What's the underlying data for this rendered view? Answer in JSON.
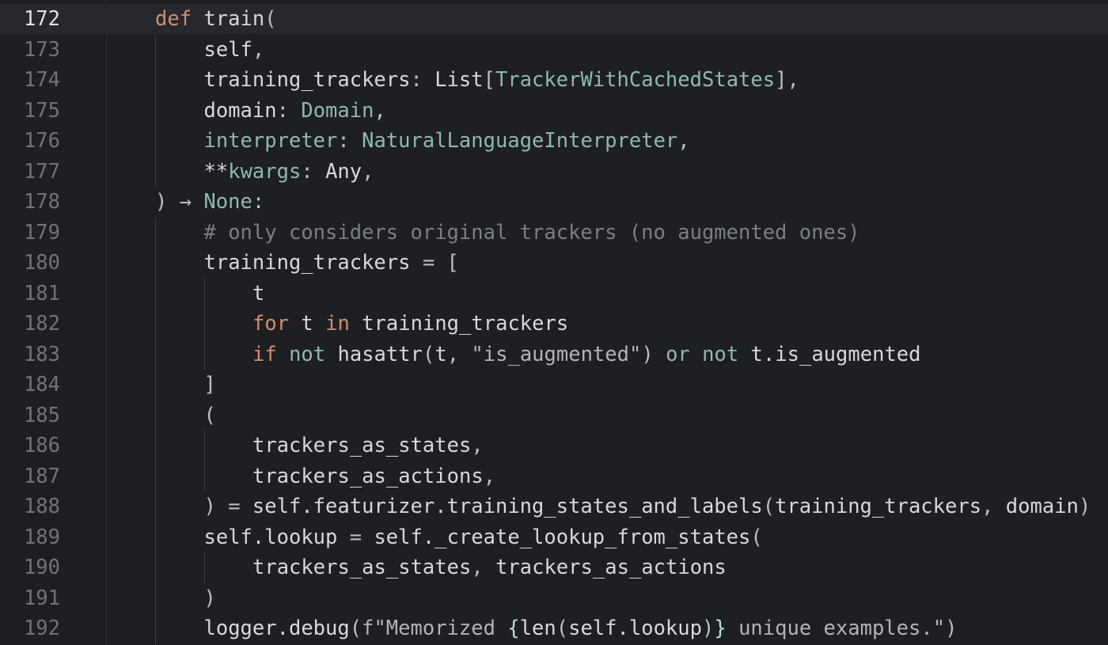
{
  "editor": {
    "current_line": 172,
    "lines": [
      {
        "n": "172",
        "current": true,
        "indent": 0,
        "tokens": [
          [
            "kw",
            "def"
          ],
          [
            "pu",
            " "
          ],
          [
            "fn",
            "train"
          ],
          [
            "pu",
            "("
          ]
        ]
      },
      {
        "n": "173",
        "indent": 1,
        "tokens": [
          [
            "id",
            "self"
          ],
          [
            "pu",
            ","
          ]
        ]
      },
      {
        "n": "174",
        "indent": 1,
        "tokens": [
          [
            "id",
            "training_trackers"
          ],
          [
            "pu",
            ": "
          ],
          [
            "id",
            "List"
          ],
          [
            "pu",
            "["
          ],
          [
            "ty",
            "TrackerWithCachedStates"
          ],
          [
            "pu",
            "],"
          ]
        ]
      },
      {
        "n": "175",
        "indent": 1,
        "tokens": [
          [
            "id",
            "domain"
          ],
          [
            "pu",
            ": "
          ],
          [
            "ty",
            "Domain"
          ],
          [
            "pu",
            ","
          ]
        ]
      },
      {
        "n": "176",
        "indent": 1,
        "tokens": [
          [
            "ty",
            "interpreter"
          ],
          [
            "pu",
            ": "
          ],
          [
            "ty",
            "NaturalLanguageInterpreter"
          ],
          [
            "pu",
            ","
          ]
        ]
      },
      {
        "n": "177",
        "indent": 1,
        "tokens": [
          [
            "id",
            "**"
          ],
          [
            "ty",
            "kwargs"
          ],
          [
            "pu",
            ": "
          ],
          [
            "id",
            "Any"
          ],
          [
            "pu",
            ","
          ]
        ]
      },
      {
        "n": "178",
        "indent": 0,
        "tokens": [
          [
            "pu",
            ") → "
          ],
          [
            "ty",
            "None"
          ],
          [
            "pu",
            ":"
          ]
        ]
      },
      {
        "n": "179",
        "indent": 1,
        "tokens": [
          [
            "cm",
            "# only considers original trackers (no augmented ones)"
          ]
        ]
      },
      {
        "n": "180",
        "indent": 1,
        "tokens": [
          [
            "id",
            "training_trackers"
          ],
          [
            "pu",
            " = ["
          ]
        ]
      },
      {
        "n": "181",
        "indent": 2,
        "tokens": [
          [
            "id",
            "t"
          ]
        ]
      },
      {
        "n": "182",
        "indent": 2,
        "tokens": [
          [
            "kw",
            "for"
          ],
          [
            "pu",
            " "
          ],
          [
            "id",
            "t"
          ],
          [
            "pu",
            " "
          ],
          [
            "kw",
            "in"
          ],
          [
            "pu",
            " "
          ],
          [
            "id",
            "training_trackers"
          ]
        ]
      },
      {
        "n": "183",
        "indent": 2,
        "tokens": [
          [
            "kw",
            "if"
          ],
          [
            "pu",
            " "
          ],
          [
            "ty",
            "not"
          ],
          [
            "pu",
            " "
          ],
          [
            "id",
            "hasattr"
          ],
          [
            "pu",
            "("
          ],
          [
            "id",
            "t"
          ],
          [
            "pu",
            ", "
          ],
          [
            "st",
            "\"is_augmented\""
          ],
          [
            "pu",
            ") "
          ],
          [
            "ty",
            "or"
          ],
          [
            "pu",
            " "
          ],
          [
            "ty",
            "not"
          ],
          [
            "pu",
            " "
          ],
          [
            "id",
            "t.is_augmented"
          ]
        ]
      },
      {
        "n": "184",
        "indent": 1,
        "tokens": [
          [
            "pu",
            "]"
          ]
        ]
      },
      {
        "n": "185",
        "indent": 1,
        "tokens": [
          [
            "pu",
            "("
          ]
        ]
      },
      {
        "n": "186",
        "indent": 2,
        "tokens": [
          [
            "id",
            "trackers_as_states"
          ],
          [
            "pu",
            ","
          ]
        ]
      },
      {
        "n": "187",
        "indent": 2,
        "tokens": [
          [
            "id",
            "trackers_as_actions"
          ],
          [
            "pu",
            ","
          ]
        ]
      },
      {
        "n": "188",
        "indent": 1,
        "tokens": [
          [
            "pu",
            ") = "
          ],
          [
            "id",
            "self.featurizer.training_states_and_labels"
          ],
          [
            "pu",
            "("
          ],
          [
            "id",
            "training_trackers"
          ],
          [
            "pu",
            ", "
          ],
          [
            "id",
            "domain"
          ],
          [
            "pu",
            ")"
          ]
        ]
      },
      {
        "n": "189",
        "indent": 1,
        "tokens": [
          [
            "id",
            "self.lookup"
          ],
          [
            "pu",
            " = "
          ],
          [
            "id",
            "self._create_lookup_from_states"
          ],
          [
            "pu",
            "("
          ]
        ]
      },
      {
        "n": "190",
        "indent": 2,
        "tokens": [
          [
            "id",
            "trackers_as_states"
          ],
          [
            "pu",
            ", "
          ],
          [
            "id",
            "trackers_as_actions"
          ]
        ]
      },
      {
        "n": "191",
        "indent": 1,
        "tokens": [
          [
            "pu",
            ")"
          ]
        ]
      },
      {
        "n": "192",
        "indent": 1,
        "tokens": [
          [
            "id",
            "logger.debug"
          ],
          [
            "pu",
            "("
          ],
          [
            "st",
            "f\"Memorized "
          ],
          [
            "tq",
            "{"
          ],
          [
            "id",
            "len"
          ],
          [
            "pu",
            "("
          ],
          [
            "id",
            "self.lookup"
          ],
          [
            "pu",
            ")"
          ],
          [
            "tq",
            "}"
          ],
          [
            "st",
            " unique examples.\""
          ],
          [
            "pu",
            ")"
          ]
        ]
      }
    ]
  },
  "colors": {
    "background": "#1e1f22",
    "current_line": "#26282e",
    "keyword": "#cf8e6d",
    "type_hint": "#8fb9ad",
    "comment": "#7a7e85",
    "line_number": "#6f737a"
  }
}
